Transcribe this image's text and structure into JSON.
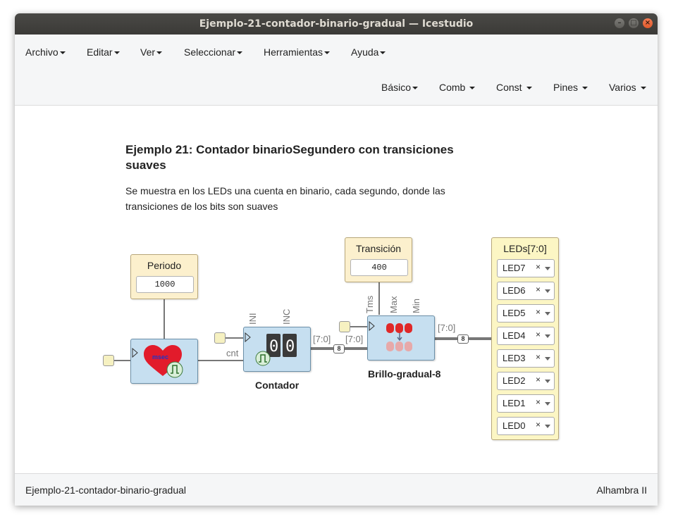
{
  "window": {
    "title": "Ejemplo-21-contador-binario-gradual — Icestudio"
  },
  "menu": {
    "top": [
      "Archivo",
      "Editar",
      "Ver",
      "Seleccionar",
      "Herramientas",
      "Ayuda"
    ],
    "blocks": [
      "Básico",
      "Comb",
      "Const",
      "Pines",
      "Varios"
    ]
  },
  "canvas": {
    "heading": "Ejemplo 21: Contador binarioSegundero con transiciones suaves",
    "description": "Se muestra en los LEDs una cuenta en binario, cada segundo, donde las transiciones de los bits son suaves",
    "periodo": {
      "label": "Periodo",
      "value": "1000"
    },
    "transicion": {
      "label": "Transición",
      "value": "400"
    },
    "timer": {
      "out_port": "cnt",
      "icon_text": "msec"
    },
    "contador": {
      "name": "Contador",
      "ports": {
        "ini": "INI",
        "inc": "INC"
      },
      "out_port": "[7:0]"
    },
    "brillo": {
      "name": "Brillo-gradual-8",
      "in_port": "[7:0]",
      "out_port": "[7:0]",
      "params": [
        "Tms",
        "Max",
        "Min"
      ]
    },
    "bus_width": "8",
    "leds": {
      "label": "LEDs[7:0]",
      "items": [
        "LED7",
        "LED6",
        "LED5",
        "LED4",
        "LED3",
        "LED2",
        "LED1",
        "LED0"
      ],
      "clear": "×"
    }
  },
  "status": {
    "left": "Ejemplo-21-contador-binario-gradual",
    "right": "Alhambra II"
  },
  "colors": {
    "constant_bg": "#fcf0cd",
    "block_bg": "#c6dff0",
    "led_panel_bg": "#fcf6c4",
    "wire": "#777777"
  }
}
